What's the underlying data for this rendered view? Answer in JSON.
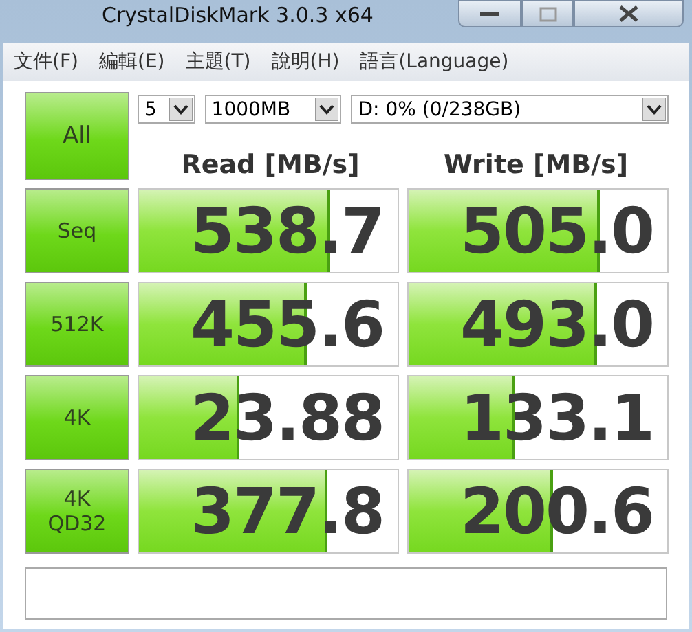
{
  "window": {
    "title": "CrystalDiskMark 3.0.3 x64"
  },
  "menu": [
    {
      "label": "文件(F)"
    },
    {
      "label": "編輯(E)"
    },
    {
      "label": "主題(T)"
    },
    {
      "label": "說明(H)"
    },
    {
      "label": "語言(Language)"
    }
  ],
  "all_button": {
    "label": "All"
  },
  "selectors": [
    {
      "value": "5"
    },
    {
      "value": "1000MB"
    },
    {
      "value": "D: 0% (0/238GB)"
    }
  ],
  "columns": [
    "Read [MB/s]",
    "Write [MB/s]"
  ],
  "rows": [
    {
      "label": "Seq",
      "read": {
        "value": "538.7",
        "level": 0.73
      },
      "write": {
        "value": "505.0",
        "level": 0.73
      }
    },
    {
      "label": "512K",
      "read": {
        "value": "455.6",
        "level": 0.64
      },
      "write": {
        "value": "493.0",
        "level": 0.72
      }
    },
    {
      "label": "4K",
      "read": {
        "value": "23.88",
        "level": 0.38
      },
      "write": {
        "value": "133.1",
        "level": 0.4
      }
    },
    {
      "label": "4K\nQD32",
      "read": {
        "value": "377.8",
        "level": 0.72
      },
      "write": {
        "value": "200.6",
        "level": 0.55
      }
    }
  ]
}
